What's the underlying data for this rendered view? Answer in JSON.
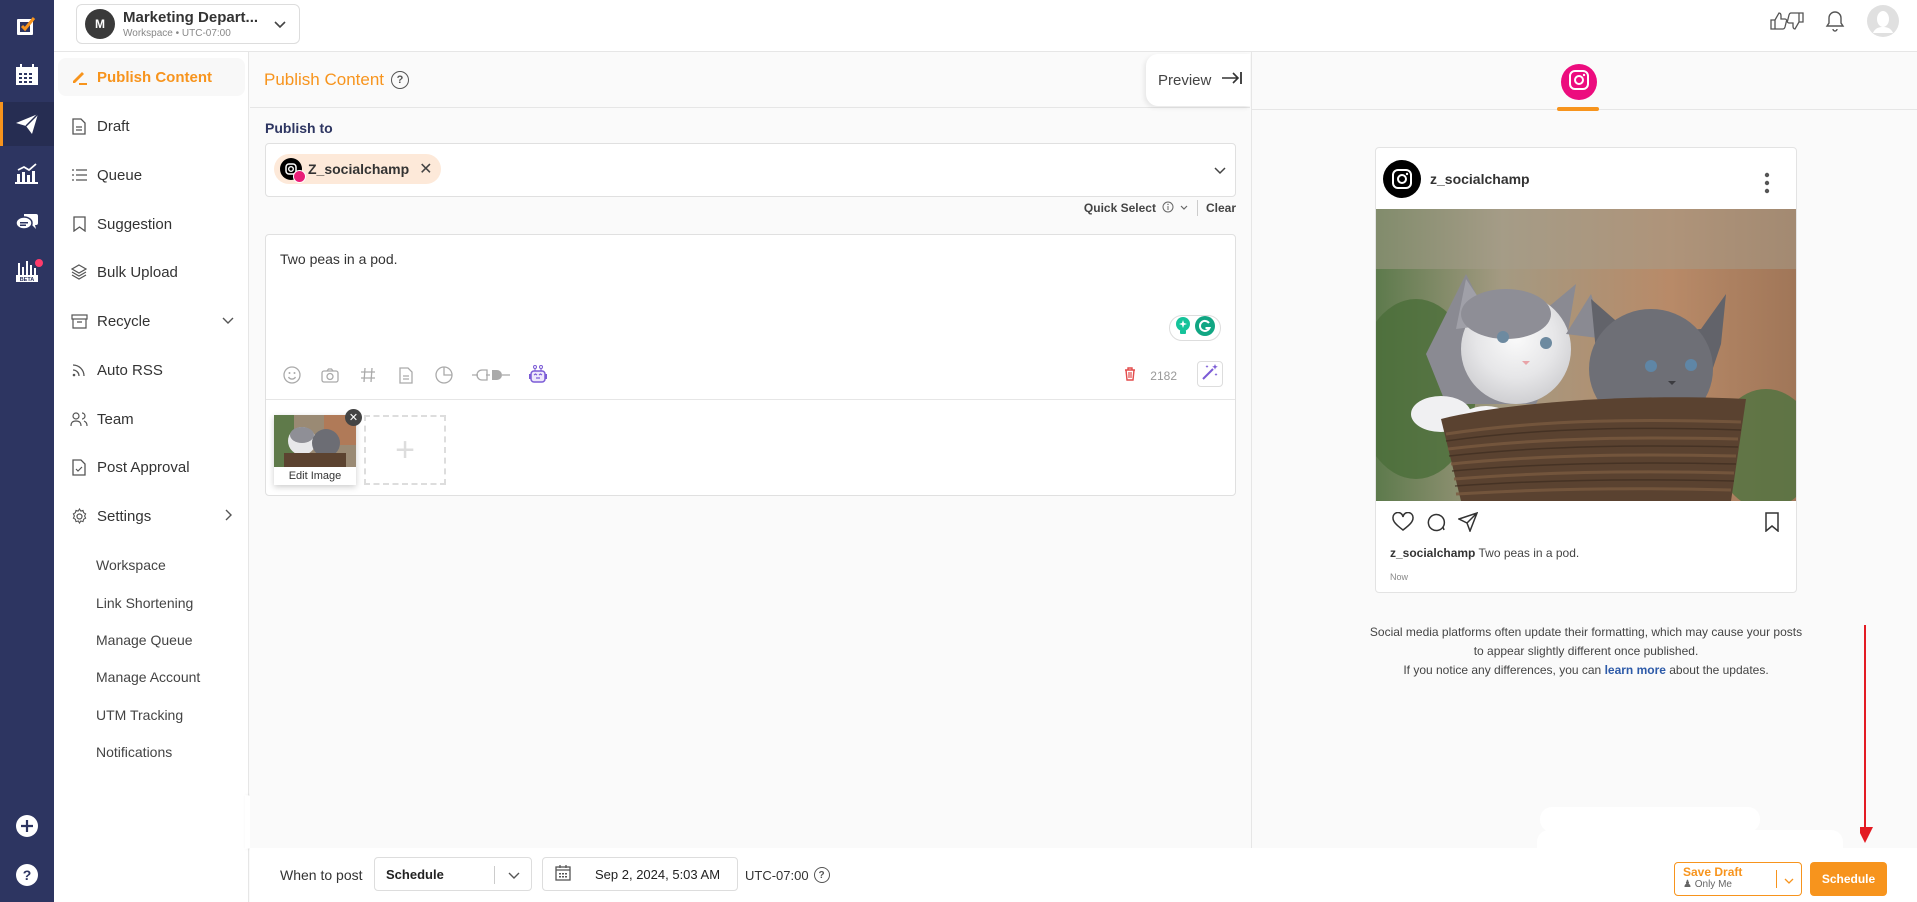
{
  "workspace": {
    "avatar_letter": "M",
    "name": "Marketing Depart...",
    "subtitle": "Workspace • UTC-07:00"
  },
  "rail": {
    "items": [
      {
        "icon": "logo-checkbox-icon"
      },
      {
        "icon": "calendar-icon"
      },
      {
        "icon": "paper-plane-icon",
        "active": true
      },
      {
        "icon": "analytics-icon"
      },
      {
        "icon": "chat-bubbles-icon"
      },
      {
        "icon": "beta-analytics-icon",
        "badge": true
      }
    ],
    "bottom": [
      {
        "icon": "plus-circle-icon"
      },
      {
        "icon": "help-circle-icon"
      }
    ]
  },
  "sidebar": {
    "items": [
      {
        "label": "Publish Content",
        "icon": "pencil-icon",
        "active": true
      },
      {
        "label": "Draft",
        "icon": "document-icon"
      },
      {
        "label": "Queue",
        "icon": "list-icon"
      },
      {
        "label": "Suggestion",
        "icon": "bookmark-icon"
      },
      {
        "label": "Bulk Upload",
        "icon": "layers-icon"
      },
      {
        "label": "Recycle",
        "icon": "archive-icon",
        "expand": "down"
      },
      {
        "label": "Auto RSS",
        "icon": "rss-icon"
      },
      {
        "label": "Team",
        "icon": "users-icon"
      },
      {
        "label": "Post Approval",
        "icon": "file-check-icon"
      },
      {
        "label": "Settings",
        "icon": "gear-icon",
        "expand": "right"
      }
    ],
    "settings_sub": [
      "Workspace",
      "Link Shortening",
      "Manage Queue",
      "Manage Account",
      "UTM Tracking",
      "Notifications"
    ]
  },
  "main": {
    "title": "Publish Content",
    "preview_label": "Preview",
    "publish_to_label": "Publish to",
    "account_chip": "Z_socialchamp",
    "quick_select": "Quick Select",
    "clear": "Clear",
    "post_text": "Two peas in a pod.",
    "char_count": "2182",
    "edit_image_label": "Edit Image"
  },
  "bottom": {
    "when_label": "When to post",
    "mode": "Schedule",
    "datetime": "Sep 2, 2024, 5:03 AM",
    "timezone": "UTC-07:00",
    "save_draft": "Save Draft",
    "save_draft_sub": "Only Me",
    "schedule_button": "Schedule"
  },
  "preview": {
    "username": "z_socialchamp",
    "caption_user": "z_socialchamp",
    "caption_text": "Two peas in a pod.",
    "time": "Now",
    "note_line1": "Social media platforms often update their formatting, which may cause your posts",
    "note_line2": "to appear slightly different once published.",
    "note_line3_pre": "If you notice any differences, you can ",
    "note_link": "learn more",
    "note_line3_post": " about the updates."
  },
  "colors": {
    "accent": "#f7941d",
    "rail": "#2d3561",
    "instagram": "#ec0c7e",
    "link": "#2d5aa8",
    "annotation_arrow": "#e31b23"
  }
}
